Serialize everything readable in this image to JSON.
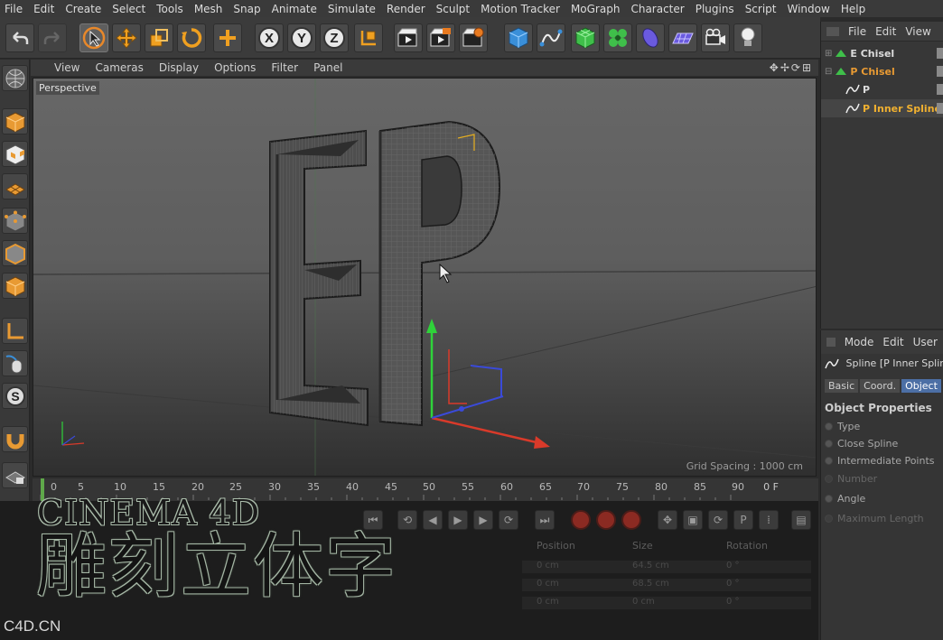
{
  "menubar": [
    "File",
    "Edit",
    "Create",
    "Select",
    "Tools",
    "Mesh",
    "Snap",
    "Animate",
    "Simulate",
    "Render",
    "Sculpt",
    "Motion Tracker",
    "MoGraph",
    "Character",
    "Plugins",
    "Script",
    "Window",
    "Help"
  ],
  "toolbar": {
    "icons": [
      "undo-icon",
      "redo-icon",
      "live-selection-icon",
      "move-icon",
      "scale-icon",
      "rotate-icon",
      "add-icon",
      "x-axis-icon",
      "y-axis-icon",
      "z-axis-icon",
      "coordinate-system-icon",
      "render-view-icon",
      "render-picture-viewer-icon",
      "render-settings-icon",
      "cube-icon",
      "pen-spline-icon",
      "subdivision-icon",
      "cloner-icon",
      "deformer-icon",
      "floor-icon",
      "camera-icon",
      "light-icon"
    ],
    "axis_labels": [
      "X",
      "Y",
      "Z"
    ]
  },
  "viewport": {
    "menu": [
      "View",
      "Cameras",
      "Display",
      "Options",
      "Filter",
      "Panel"
    ],
    "nav_glyphs": "✥✢⟳⊞",
    "label": "Perspective",
    "grid_spacing": "Grid Spacing : 1000 cm",
    "letters": [
      "E",
      "P"
    ]
  },
  "timeline": {
    "ticks": [
      "0",
      "5",
      "10",
      "15",
      "20",
      "25",
      "30",
      "35",
      "40",
      "45",
      "50",
      "55",
      "60",
      "65",
      "70",
      "75",
      "80",
      "85",
      "90"
    ],
    "frame": "0 F"
  },
  "coord_panel": {
    "headers": [
      "Position",
      "Size",
      "Rotation"
    ],
    "rows": [
      [
        "0 cm",
        "64.5 cm",
        "0 °"
      ],
      [
        "0 cm",
        "68.5 cm",
        "0 °"
      ],
      [
        "0 cm",
        "0 cm",
        "0 °"
      ]
    ]
  },
  "overlay": {
    "title_en": "CINEMA 4D",
    "title_cn": "雕刻立体字",
    "watermark": "C4D.CN"
  },
  "object_manager": {
    "menu": [
      "File",
      "Edit",
      "View"
    ],
    "objects": [
      {
        "name": "E Chisel"
      },
      {
        "name": "P Chisel"
      },
      {
        "name": "P"
      },
      {
        "name": "P Inner Spline"
      }
    ]
  },
  "attribute_manager": {
    "menu": [
      "Mode",
      "Edit",
      "User"
    ],
    "object_label": "Spline [P Inner Spline]",
    "tabs": [
      "Basic",
      "Coord.",
      "Object"
    ],
    "active_tab": "Object",
    "section": "Object Properties",
    "properties": [
      "Type",
      "Close Spline",
      "Intermediate Points",
      "Number",
      "Angle",
      "Maximum Length"
    ]
  },
  "colors": {
    "accent_orange": "#e89a33",
    "tab_blue": "#4c6fa5",
    "timeline_green": "#5fa84a",
    "y_axis_green": "#2fd23a",
    "x_axis_red": "#d93a2a",
    "z_axis_blue": "#3a4ad9"
  }
}
